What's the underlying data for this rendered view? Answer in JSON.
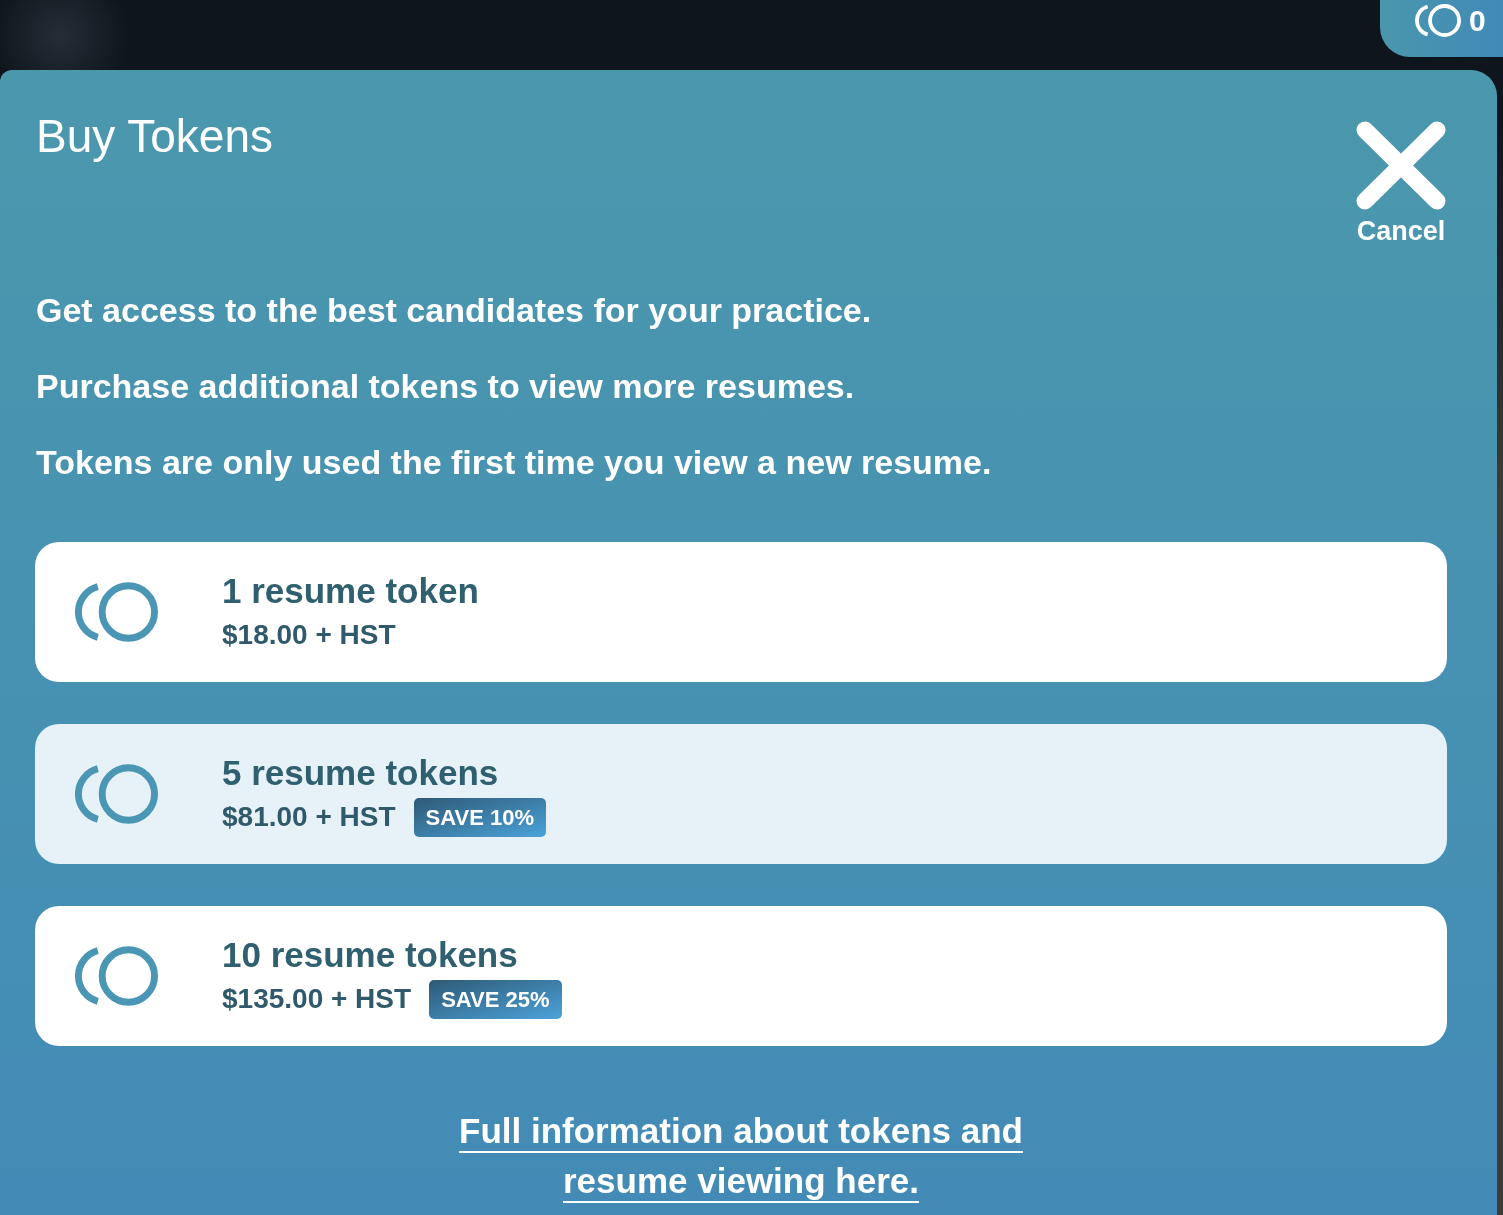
{
  "top_bar": {
    "token_balance": {
      "count": "0"
    }
  },
  "modal": {
    "title": "Buy Tokens",
    "cancel_button": {
      "label": "Cancel"
    },
    "paragraphs": [
      "Get access to the best candidates for your practice.",
      "Purchase additional tokens to view more resumes.",
      "Tokens are only used the first time you view a new resume."
    ],
    "packages": [
      {
        "name": "1 resume token",
        "price": "$18.00 + HST",
        "selected": false
      },
      {
        "name": "5 resume tokens",
        "price": "$81.00 + HST",
        "badge": "SAVE 10%",
        "selected": true
      },
      {
        "name": "10 resume tokens",
        "price": "$135.00 + HST",
        "badge": "SAVE 25%",
        "selected": false
      }
    ],
    "info_link": "Full information about tokens and resume viewing here."
  }
}
